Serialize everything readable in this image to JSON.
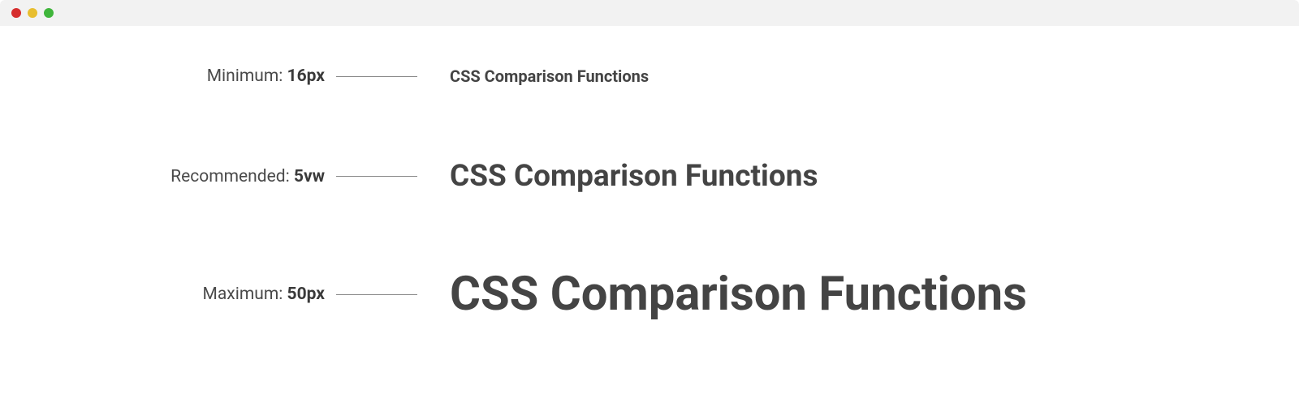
{
  "rows": [
    {
      "label_prefix": "Minimum: ",
      "label_value": "16px",
      "sample_text": "CSS Comparison Functions",
      "size_class": "sample-min"
    },
    {
      "label_prefix": "Recommended: ",
      "label_value": "5vw",
      "sample_text": "CSS Comparison Functions",
      "size_class": "sample-mid"
    },
    {
      "label_prefix": "Maximum: ",
      "label_value": "50px",
      "sample_text": "CSS Comparison Functions",
      "size_class": "sample-max"
    }
  ]
}
